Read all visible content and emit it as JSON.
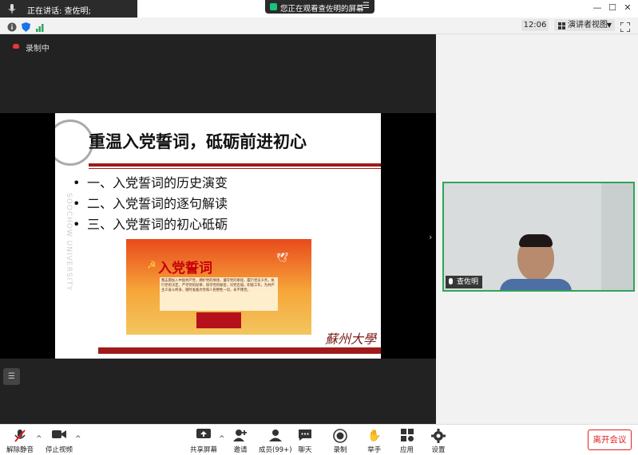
{
  "window": {
    "speaking_label": "正在讲话: 查佐明;",
    "share_banner": "您正在观看查佐明的屏幕",
    "clock": "12:06",
    "view_mode": "演讲者视图",
    "minimize": "—",
    "maximize": "☐",
    "close": "✕"
  },
  "recording_status": "录制中",
  "slide": {
    "title": "重温入党誓词，砥砺前进初心",
    "bullets": [
      "一、入党誓词的历史演变",
      "二、入党誓词的逐句解读",
      "三、入党誓词的初心砥砺"
    ],
    "banner_title": "入党誓词",
    "oath_text": "我志愿加入中国共产党，拥护党的纲领，遵守党的章程，履行党员义务，执行党的决定，严守党的纪律，保守党的秘密，对党忠诚，积极工作，为共产主义奋斗终身，随时准备为党和人民牺牲一切，永不叛党。",
    "vertical_text": "SOOCHOW UNIVERSITY",
    "calligraphy": "蘇州大學"
  },
  "participant": {
    "name": "查佐明"
  },
  "toolbar": {
    "unmute": "解除静音",
    "stop_video": "停止视频",
    "share_screen": "共享屏幕",
    "invite": "邀请",
    "participants": "成员(99+)",
    "chat": "聊天",
    "record": "录制",
    "raise_hand": "举手",
    "apps": "应用",
    "settings": "设置",
    "leave": "离开会议"
  },
  "colors": {
    "accent_red": "#e02020",
    "active_green": "#2ea55a",
    "slide_red": "#a01a1a"
  }
}
